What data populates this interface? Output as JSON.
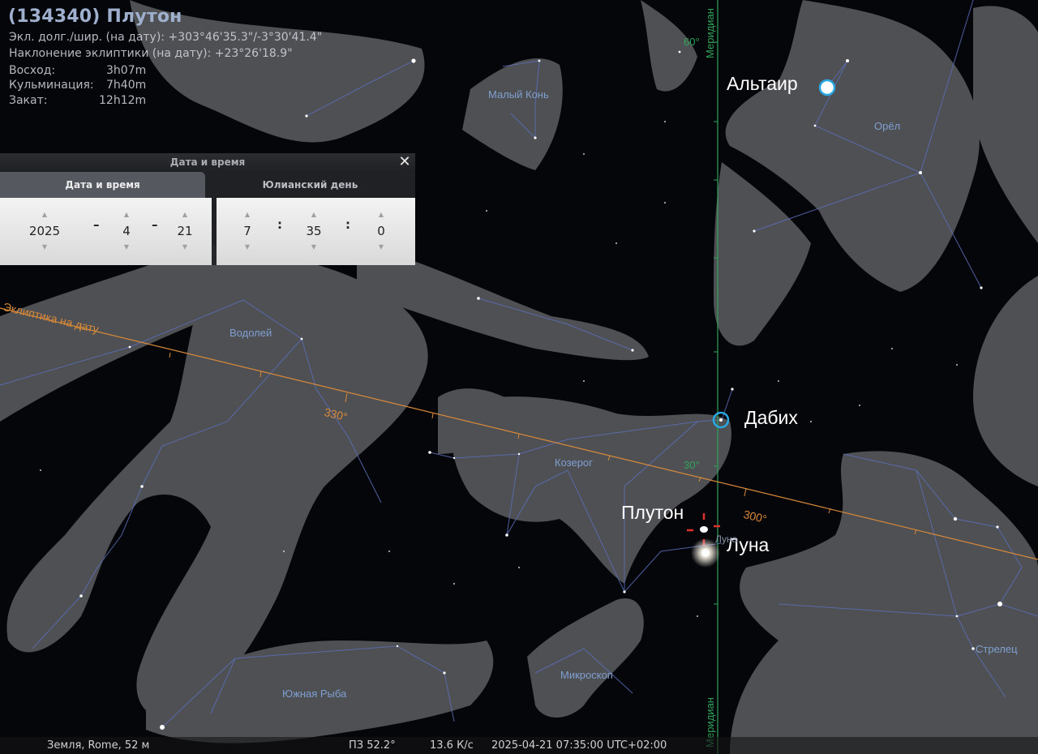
{
  "object_info": {
    "title": "(134340) Плутон",
    "ecliptic_line": "Экл. долг./шир. (на дату): +303°46'35.3\"/-3°30'41.4\"",
    "obliquity_line": "Наклонение эклиптики (на дату): +23°26'18.9\"",
    "rise_label": "Восход:",
    "rise_value": "3h07m",
    "transit_label": "Кульминация:",
    "transit_value": "7h40m",
    "set_label": "Закат:",
    "set_value": "12h12m"
  },
  "datetime_dialog": {
    "title": "Дата и время",
    "close_icon": "close-icon",
    "tabs": [
      "Дата и время",
      "Юлианский день"
    ],
    "year": "2025",
    "month": "4",
    "day": "21",
    "hour": "7",
    "minute": "35",
    "second": "0",
    "date_sep": "–",
    "time_sep": ":"
  },
  "sky_labels": {
    "altair": "Альтаир",
    "dabih": "Дабих",
    "pluto": "Плутон",
    "moon": "Луна",
    "moon_small": "Луна"
  },
  "constellations": {
    "equuleus": "Малый Конь",
    "aquila": "Орёл",
    "aquarius": "Водолей",
    "capricornus": "Козерог",
    "sagittarius": "Стрелец",
    "microscopium": "Микроскоп",
    "piscis_austrinus": "Южная Рыба"
  },
  "grid_labels": {
    "ecliptic": "Эклиптика на дату",
    "ecl_330": "330°",
    "ecl_300": "300°",
    "meridian_top": "Меридиан",
    "meridian_bottom": "Меридиан",
    "mer_60": "60°",
    "mer_30": "30°"
  },
  "status_bar": {
    "location": "Земля, Rome, 52 м",
    "fov": "ПЗ 52.2°",
    "fps": "13.6 К/с",
    "datetime": "2025-04-21 07:35:00 UTC+02:00"
  },
  "colors": {
    "ecliptic": "#d98a39",
    "meridian": "#2fa45a",
    "constellation_lines": "#5a6fb8",
    "constellation_labels": "#7f9fd0",
    "marker": "#29a7e0",
    "pluto_marker": "#e0302c"
  }
}
